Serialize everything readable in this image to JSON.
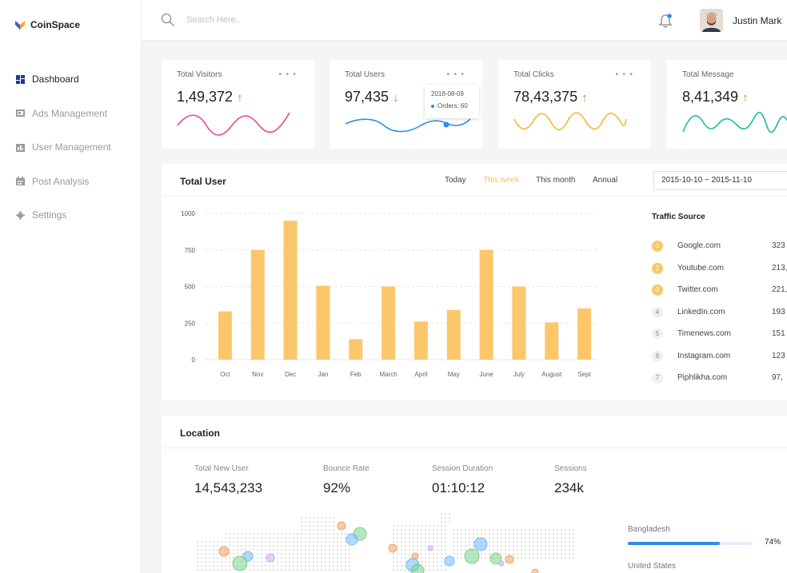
{
  "app": {
    "name": "CoinSpace"
  },
  "sidebar": {
    "items": [
      {
        "label": "Dashboard",
        "icon": "dashboard-icon",
        "active": true
      },
      {
        "label": "Ads Management",
        "icon": "ads-icon",
        "active": false
      },
      {
        "label": "User Management",
        "icon": "users-icon",
        "active": false
      },
      {
        "label": "Post Analysis",
        "icon": "analysis-icon",
        "active": false
      },
      {
        "label": "Settings",
        "icon": "settings-icon",
        "active": false
      }
    ]
  },
  "topbar": {
    "search_placeholder": "Search Here..",
    "user_name": "Justin Mark"
  },
  "stats": [
    {
      "label": "Total Visitors",
      "value": "1,49,372",
      "trend": "up",
      "arrow": "↑",
      "color": "#e84393"
    },
    {
      "label": "Total Users",
      "value": "97,435",
      "trend": "down",
      "arrow": "↓",
      "color": "#2d8cf0"
    },
    {
      "label": "Total Clicks",
      "value": "78,43,375",
      "trend": "up",
      "arrow": "↑",
      "color": "#f5b82e"
    },
    {
      "label": "Total Message",
      "value": "8,41,349",
      "trend": "up",
      "arrow": "↑",
      "color": "#1abc9c"
    }
  ],
  "stat_dots": "• • •",
  "tooltip": {
    "date": "2018-08-09",
    "label": "Orders: 60"
  },
  "total_user": {
    "title": "Total User",
    "periods": [
      "Today",
      "This week",
      "This month",
      "Annual"
    ],
    "active_period": "This week",
    "date_range": "2015-10-10 ~ 2015-11-10"
  },
  "chart_data": {
    "type": "bar",
    "categories": [
      "Oct",
      "Nov",
      "Dec",
      "Jan",
      "Feb",
      "March",
      "April",
      "May",
      "June",
      "July",
      "August",
      "Sept"
    ],
    "values": [
      330,
      750,
      950,
      505,
      140,
      500,
      260,
      340,
      750,
      500,
      255,
      350
    ],
    "yticks": [
      0,
      250,
      500,
      750,
      1000
    ],
    "ylim": [
      0,
      1000
    ],
    "bar_color": "#fcc76b",
    "grid": true
  },
  "traffic_source": {
    "title": "Traffic Source",
    "items": [
      {
        "rank": "1",
        "site": "Google.com",
        "value": "323"
      },
      {
        "rank": "2",
        "site": "Youtube.com",
        "value": "213,"
      },
      {
        "rank": "3",
        "site": "Twitter.com",
        "value": "221,"
      },
      {
        "rank": "4",
        "site": "LinkedIn.com",
        "value": "193"
      },
      {
        "rank": "5",
        "site": "Timenews.com",
        "value": "151"
      },
      {
        "rank": "6",
        "site": "Instagram.com",
        "value": "123"
      },
      {
        "rank": "7",
        "site": "Piphlikha.com",
        "value": "97,"
      }
    ]
  },
  "location": {
    "title": "Location",
    "metrics": [
      {
        "label": "Total New User",
        "value": "14,543,233"
      },
      {
        "label": "Bounce Rate",
        "value": "92%"
      },
      {
        "label": "Session Duration",
        "value": "01:10:12"
      },
      {
        "label": "Sessions",
        "value": "234k"
      }
    ],
    "countries": [
      {
        "name": "Bangladesh",
        "percent": "74%",
        "fill": 0.74
      },
      {
        "name": "United States"
      }
    ]
  }
}
